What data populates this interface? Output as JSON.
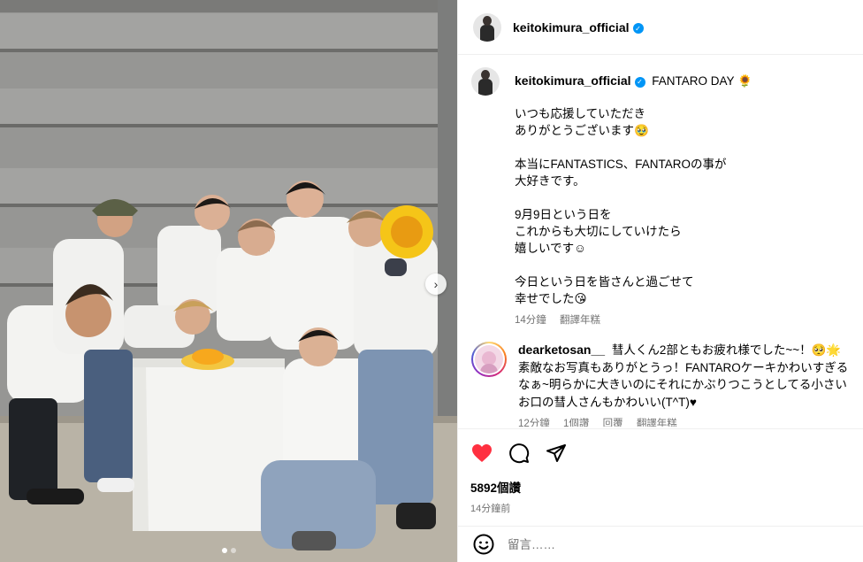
{
  "post": {
    "username": "keitokimura_official",
    "verified_icon": "verified-badge-icon",
    "photo_alt": "Group photo with cake",
    "carousel": {
      "total": 2,
      "active": 0,
      "next_icon": "chevron-right-icon"
    }
  },
  "caption": {
    "username": "keitokimura_official",
    "title": "FANTARO DAY 🌻",
    "lines": [
      "いつも応援していただき",
      "ありがとうございます🥹",
      "",
      "本当にFANTASTICS、FANTAROの事が",
      "大好きです。",
      "",
      "9月9日という日を",
      "これからも大切にしていけたら",
      "嬉しいです☺︎",
      "",
      "今日という日を皆さんと過ごせて",
      "幸せでした😘"
    ],
    "time": "14分鐘",
    "translate": "翻譯年糕"
  },
  "comment": {
    "username": "dearketosan__",
    "text": "彗人くん2部ともお疲れ様でした~~！🥺🌟素敵なお写真もありがとうっ！FANTAROケーキかわいすぎるなぁ~明らかに大きいのにそれにかぶりつこうとしてる小さいお口の彗人さんもかわいい(T^T)♥",
    "time": "12分鐘",
    "likes": "1個讚",
    "reply": "回覆",
    "translate": "翻譯年糕"
  },
  "actions": {
    "like_icon": "heart-filled-icon",
    "comment_icon": "comment-icon",
    "share_icon": "send-icon",
    "likes_count": "5892個讚",
    "posted_time": "14分鐘前",
    "like_color": "#ff3040"
  },
  "add_comment": {
    "emoji_icon": "emoji-icon",
    "placeholder": "留言……"
  }
}
